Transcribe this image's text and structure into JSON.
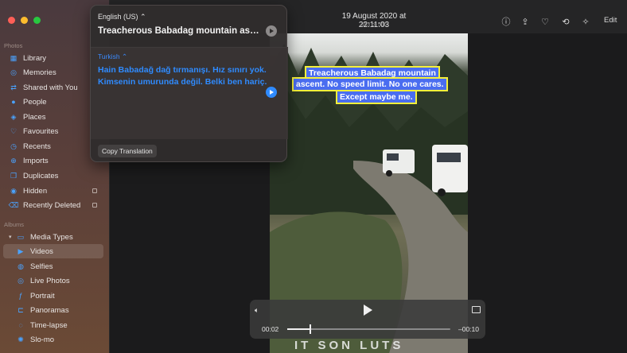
{
  "window": {
    "title_date": "19 August 2020 at 22:11:03",
    "title_count": "353 of 566"
  },
  "toolbar": {
    "icons": [
      "info-icon",
      "share-icon",
      "heart-icon",
      "rotate-icon",
      "enhance-icon"
    ],
    "edit_label": "Edit"
  },
  "sidebar": {
    "photos_header": "Photos",
    "items": [
      {
        "label": "Library",
        "icon": "library-icon"
      },
      {
        "label": "Memories",
        "icon": "memories-icon"
      },
      {
        "label": "Shared with You",
        "icon": "shared-icon"
      },
      {
        "label": "People",
        "icon": "people-icon"
      },
      {
        "label": "Places",
        "icon": "places-icon"
      },
      {
        "label": "Favourites",
        "icon": "heart-icon"
      },
      {
        "label": "Recents",
        "icon": "clock-icon"
      },
      {
        "label": "Imports",
        "icon": "imports-icon"
      },
      {
        "label": "Duplicates",
        "icon": "duplicates-icon"
      },
      {
        "label": "Hidden",
        "icon": "hidden-icon",
        "locked": true
      },
      {
        "label": "Recently Deleted",
        "icon": "trash-icon",
        "locked": true
      }
    ],
    "albums_header": "Albums",
    "media_types_label": "Media Types",
    "media_items": [
      {
        "label": "Videos",
        "selected": true
      },
      {
        "label": "Selfies"
      },
      {
        "label": "Live Photos"
      },
      {
        "label": "Portrait"
      },
      {
        "label": "Panoramas"
      },
      {
        "label": "Time-lapse"
      },
      {
        "label": "Slo-mo"
      }
    ]
  },
  "photo": {
    "ocr_lines": [
      "Treacherous Babadag mountain",
      "ascent. No speed limit. No one cares.",
      "Except maybe me."
    ],
    "bottom_overlay_text": "IT SON LUTS"
  },
  "video": {
    "current_time": "00:02",
    "remaining_time": "–00:10",
    "progress": 0.14
  },
  "translation": {
    "source_language": "English (US)",
    "source_text": "Treacherous Babadag mountain asc...",
    "target_language": "Turkish",
    "target_text": "Hain Babadağ dağ tırmanışı. Hız sınırı yok. Kimsenin umurunda değil. Belki ben hariç.",
    "copy_label": "Copy Translation"
  }
}
